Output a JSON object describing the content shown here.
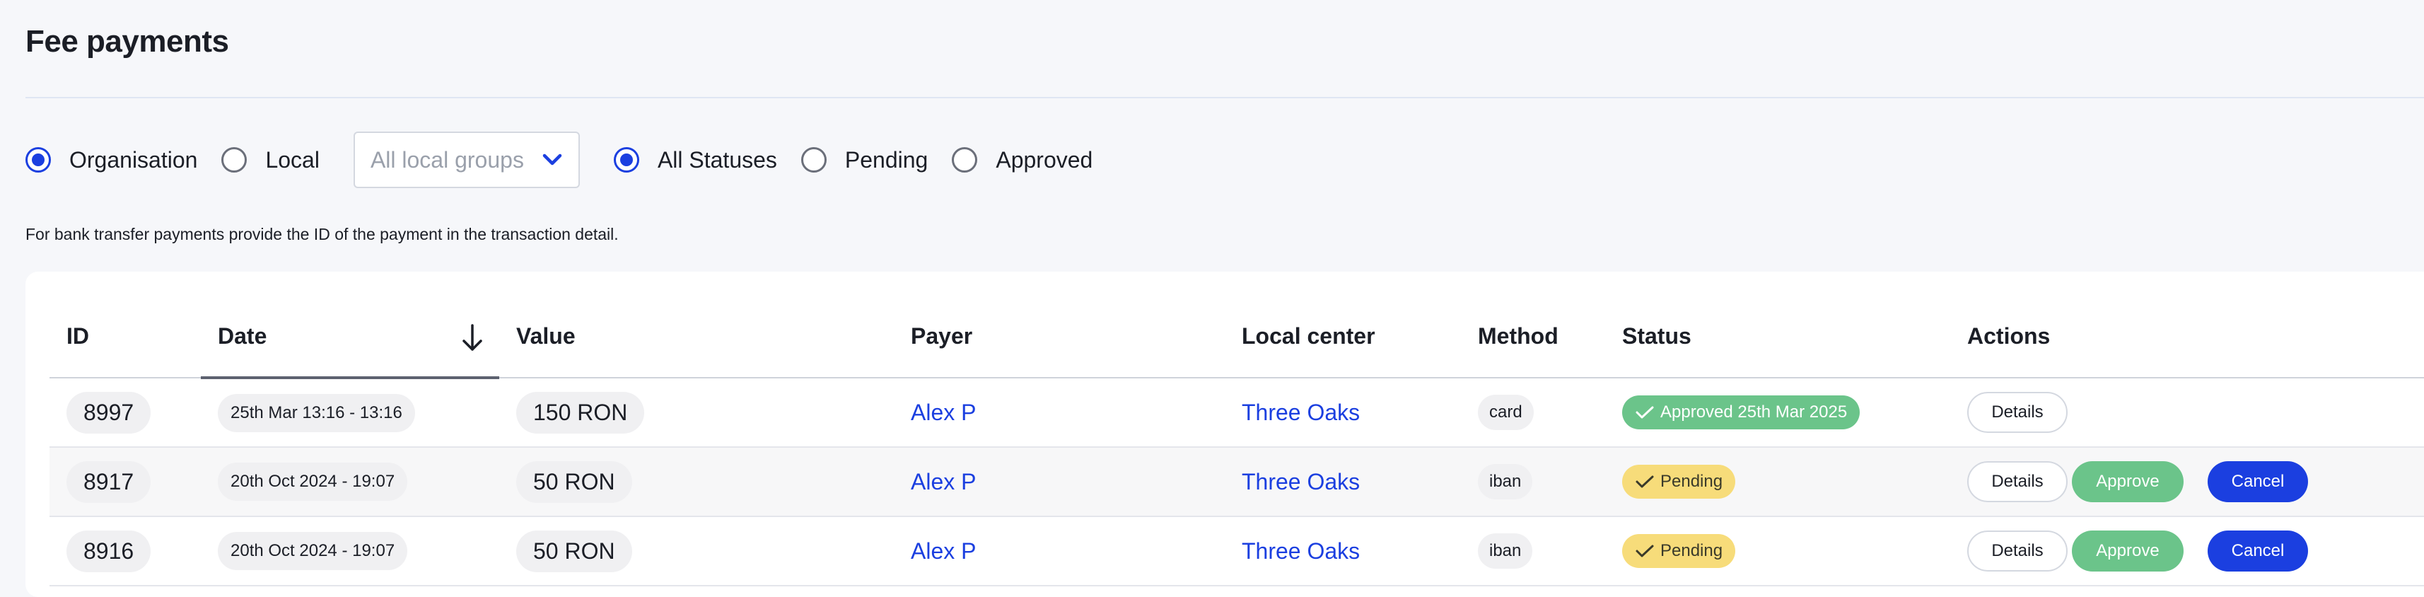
{
  "page": {
    "title": "Fee payments",
    "info": "For bank transfer payments provide the ID of the payment in the transaction detail."
  },
  "filters": {
    "scope": [
      {
        "label": "Organisation",
        "checked": true
      },
      {
        "label": "Local",
        "checked": false
      }
    ],
    "local_group_placeholder": "All local groups",
    "status": [
      {
        "label": "All Statuses",
        "checked": true
      },
      {
        "label": "Pending",
        "checked": false
      },
      {
        "label": "Approved",
        "checked": false
      }
    ]
  },
  "table": {
    "columns": [
      "ID",
      "Date",
      "Value",
      "Payer",
      "Local center",
      "Method",
      "Status",
      "Actions"
    ],
    "sorted_column": "Date",
    "sort_direction": "descending",
    "rows": [
      {
        "id": "8997",
        "date": "25th Mar 13:16 - 13:16",
        "value": "150 RON",
        "payer": "Alex P",
        "local_center": "Three Oaks",
        "method": "card",
        "status": "Approved 25th Mar 2025",
        "status_type": "approved"
      },
      {
        "id": "8917",
        "date": "20th Oct 2024 - 19:07",
        "value": "50 RON",
        "payer": "Alex P",
        "local_center": "Three Oaks",
        "method": "iban",
        "status": "Pending",
        "status_type": "pending"
      },
      {
        "id": "8916",
        "date": "20th Oct 2024 - 19:07",
        "value": "50 RON",
        "payer": "Alex P",
        "local_center": "Three Oaks",
        "method": "iban",
        "status": "Pending",
        "status_type": "pending"
      }
    ],
    "actions": {
      "details": "Details",
      "approve": "Approve",
      "cancel": "Cancel"
    }
  },
  "icons": {
    "dropdown": "chevron-down-icon",
    "sort": "arrow-down-icon",
    "approved": "check-icon",
    "pending": "check-icon"
  },
  "colors": {
    "accent": "#1b3fe0",
    "approved": "#6bc48a",
    "pending": "#f7dc7a",
    "link": "#1b3fe0"
  }
}
